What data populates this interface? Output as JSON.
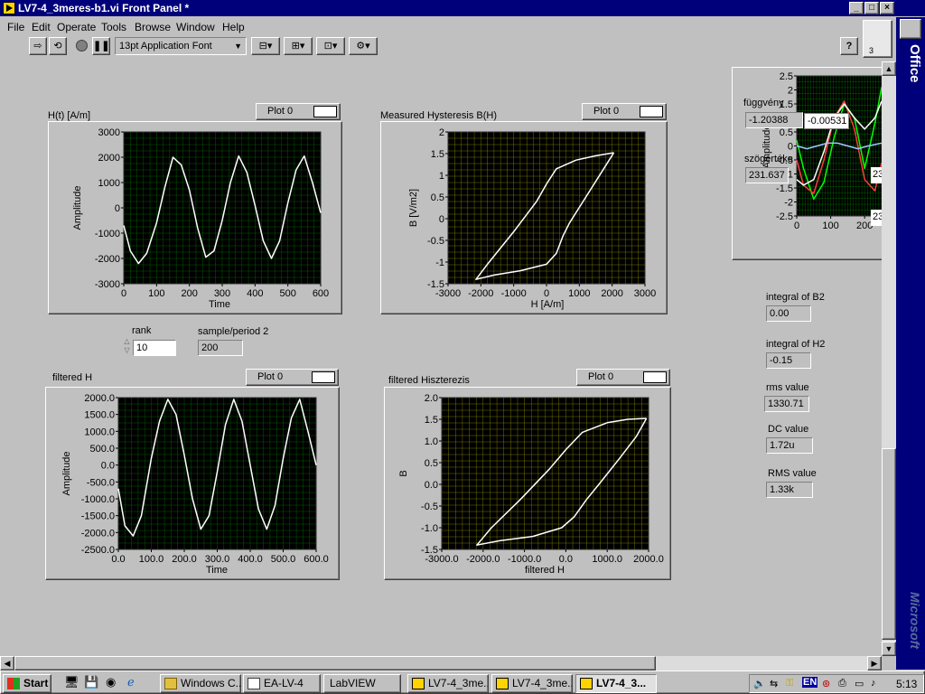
{
  "window": {
    "title": "LV7-4_3meres-b1.vi Front Panel *",
    "min": "_",
    "max": "□",
    "close": "×"
  },
  "menu": [
    "File",
    "Edit",
    "Operate",
    "Tools",
    "Browse",
    "Window",
    "Help"
  ],
  "toolbar": {
    "font": "13pt Application Font",
    "help": "?"
  },
  "graphs": {
    "ht": {
      "label": "H(t) [A/m]",
      "legend": "Plot 0",
      "xlabel": "Time",
      "ylabel": "Amplitude"
    },
    "bh": {
      "label": "Measured Hysteresis B(H)",
      "legend": "Plot 0",
      "xlabel": "H [A/m]",
      "ylabel": "B [V/m2]"
    },
    "fh": {
      "label": "filtered H",
      "legend": "Plot 0",
      "xlabel": "Time",
      "ylabel": "Amplitude"
    },
    "fhys": {
      "label": "filtered Hiszterezis",
      "legend": "Plot 0",
      "xlabel": "filtered H",
      "ylabel": "B"
    },
    "small": {
      "ylabel": "Amplitude"
    }
  },
  "controls": {
    "rank": {
      "label": "rank",
      "value": "10"
    },
    "sample": {
      "label": "sample/period 2",
      "value": "200"
    },
    "fuggveny": {
      "label": "függvény",
      "value": "-1.20388"
    },
    "cursor_value": "-0.00531",
    "szog": {
      "label": "szögértéke",
      "value": "231.637"
    },
    "edge1": "23",
    "edge2": "23",
    "intB2": {
      "label": "integral of B2",
      "value": "0.00"
    },
    "intH2": {
      "label": "integral of H2",
      "value": "-0.15"
    },
    "rms": {
      "label": "rms value",
      "value": "1330.71"
    },
    "dc": {
      "label": "DC value",
      "value": "1.72u"
    },
    "RMS": {
      "label": "RMS value",
      "value": "1.33k"
    }
  },
  "office": {
    "top": "Office",
    "bottom": "Microsoft",
    "badge": "3"
  },
  "taskbar": {
    "start": "Start",
    "tasks": [
      "Windows C...",
      "EA-LV-4",
      "LabVIEW",
      "LV7-4_3me...",
      "LV7-4_3me...",
      "LV7-4_3..."
    ],
    "clock": "5:13",
    "tray_lang": "EN"
  },
  "chart_data": [
    {
      "type": "line",
      "id": "ht",
      "title": "H(t) [A/m]",
      "xlabel": "Time",
      "ylabel": "Amplitude",
      "xlim": [
        0,
        600
      ],
      "ylim": [
        -3000,
        3000
      ],
      "xticks": [
        0,
        100,
        200,
        300,
        400,
        500,
        600
      ],
      "yticks": [
        3000,
        2000,
        1000,
        0,
        -1000,
        -2000,
        -3000
      ],
      "series": [
        {
          "name": "Plot 0",
          "x": [
            0,
            20,
            45,
            70,
            100,
            125,
            150,
            175,
            200,
            225,
            250,
            275,
            300,
            325,
            350,
            375,
            400,
            425,
            450,
            475,
            500,
            525,
            550,
            575,
            600
          ],
          "y": [
            -700,
            -1700,
            -2200,
            -1800,
            -600,
            800,
            2000,
            1700,
            700,
            -800,
            -1950,
            -1700,
            -500,
            1000,
            2050,
            1400,
            100,
            -1300,
            -2000,
            -1300,
            200,
            1500,
            2050,
            1000,
            -200
          ]
        }
      ],
      "grid": true
    },
    {
      "type": "line",
      "id": "bh",
      "title": "Measured Hysteresis B(H)",
      "xlabel": "H [A/m]",
      "ylabel": "B [V/m2]",
      "xlim": [
        -3000,
        3000
      ],
      "ylim": [
        -1.5,
        2
      ],
      "xticks": [
        -3000,
        -2000,
        -1000,
        0,
        1000,
        2000,
        3000
      ],
      "yticks": [
        2,
        1.5,
        1,
        0.5,
        0,
        -0.5,
        -1,
        -1.5
      ],
      "series": [
        {
          "name": "Plot 0",
          "x": [
            2050,
            1500,
            900,
            300,
            0,
            -300,
            -1000,
            -1800,
            -2150,
            -1600,
            -800,
            0,
            300,
            500,
            700,
            1200,
            1700,
            2050
          ],
          "y": [
            1.52,
            1.45,
            1.35,
            1.15,
            0.8,
            0.4,
            -0.3,
            -1.05,
            -1.4,
            -1.3,
            -1.2,
            -1.05,
            -0.8,
            -0.4,
            -0.1,
            0.5,
            1.1,
            1.52
          ]
        }
      ],
      "grid": true
    },
    {
      "type": "line",
      "id": "fh",
      "title": "filtered H",
      "xlabel": "Time",
      "ylabel": "Amplitude",
      "xlim": [
        0,
        600
      ],
      "ylim": [
        -2500,
        2000
      ],
      "xticks": [
        0,
        100,
        200,
        300,
        400,
        500,
        600
      ],
      "yticks": [
        2000.0,
        1500.0,
        1000.0,
        500.0,
        0.0,
        -500.0,
        -1000.0,
        -1500.0,
        -2000.0,
        -2500.0
      ],
      "series": [
        {
          "name": "Plot 0",
          "x": [
            0,
            20,
            45,
            70,
            100,
            125,
            150,
            175,
            200,
            225,
            250,
            275,
            300,
            325,
            350,
            375,
            400,
            425,
            450,
            475,
            500,
            525,
            550,
            575,
            600
          ],
          "y": [
            -700,
            -1800,
            -2100,
            -1500,
            200,
            1300,
            1950,
            1500,
            300,
            -1000,
            -1900,
            -1500,
            -200,
            1200,
            1950,
            1300,
            0,
            -1300,
            -1900,
            -1200,
            200,
            1400,
            1950,
            1000,
            0
          ]
        }
      ],
      "grid": true
    },
    {
      "type": "line",
      "id": "fhys",
      "title": "filtered Hiszterezis",
      "xlabel": "filtered H",
      "ylabel": "B",
      "xlim": [
        -3000,
        2000
      ],
      "ylim": [
        -1.5,
        2
      ],
      "xticks": [
        -3000.0,
        -2000.0,
        -1000.0,
        0.0,
        1000.0,
        2000.0
      ],
      "yticks": [
        2.0,
        1.5,
        1.0,
        0.5,
        0.0,
        -0.5,
        -1.0,
        -1.5
      ],
      "series": [
        {
          "name": "Plot 0",
          "x": [
            1950,
            1500,
            1000,
            400,
            0,
            -400,
            -1100,
            -1800,
            -2150,
            -1600,
            -800,
            -100,
            200,
            500,
            800,
            1300,
            1700,
            1950
          ],
          "y": [
            1.52,
            1.5,
            1.42,
            1.2,
            0.8,
            0.35,
            -0.35,
            -1.0,
            -1.4,
            -1.3,
            -1.2,
            -1.0,
            -0.75,
            -0.35,
            0.0,
            0.6,
            1.1,
            1.52
          ]
        }
      ],
      "grid": true
    },
    {
      "type": "line",
      "id": "small",
      "ylabel": "Amplitude",
      "xlim": [
        0,
        250
      ],
      "ylim": [
        -2.5,
        2.5
      ],
      "xticks": [
        0,
        100,
        200
      ],
      "yticks": [
        2.5,
        2,
        1.5,
        1,
        0.5,
        0,
        -0.5,
        -1,
        -1.5,
        -2,
        -2.5
      ],
      "series": [
        {
          "color": "#00ff00",
          "x": [
            0,
            20,
            50,
            80,
            110,
            140,
            170,
            200,
            230,
            250
          ],
          "y": [
            0.2,
            -0.8,
            -1.9,
            -1.3,
            0.3,
            1.5,
            1.0,
            -0.8,
            0.8,
            2.1
          ]
        },
        {
          "color": "#ff3b3b",
          "x": [
            0,
            20,
            50,
            80,
            110,
            140,
            170,
            200,
            230,
            250
          ],
          "y": [
            -0.5,
            -1.4,
            -1.7,
            -0.5,
            1.0,
            1.6,
            0.6,
            -1.2,
            -1.6,
            -0.6
          ]
        },
        {
          "color": "#ffffff",
          "x": [
            0,
            20,
            50,
            80,
            110,
            140,
            170,
            200,
            230,
            250
          ],
          "y": [
            -1.2,
            -1.4,
            -1.2,
            -0.2,
            1.0,
            1.5,
            1.0,
            0.6,
            1.0,
            1.6
          ]
        },
        {
          "color": "#a0c8ff",
          "x": [
            0,
            30,
            60,
            90,
            120,
            150,
            180,
            210,
            250
          ],
          "y": [
            0.0,
            -0.1,
            0.0,
            0.1,
            0.1,
            0.0,
            -0.1,
            0.0,
            0.1
          ]
        }
      ],
      "grid": true
    }
  ]
}
